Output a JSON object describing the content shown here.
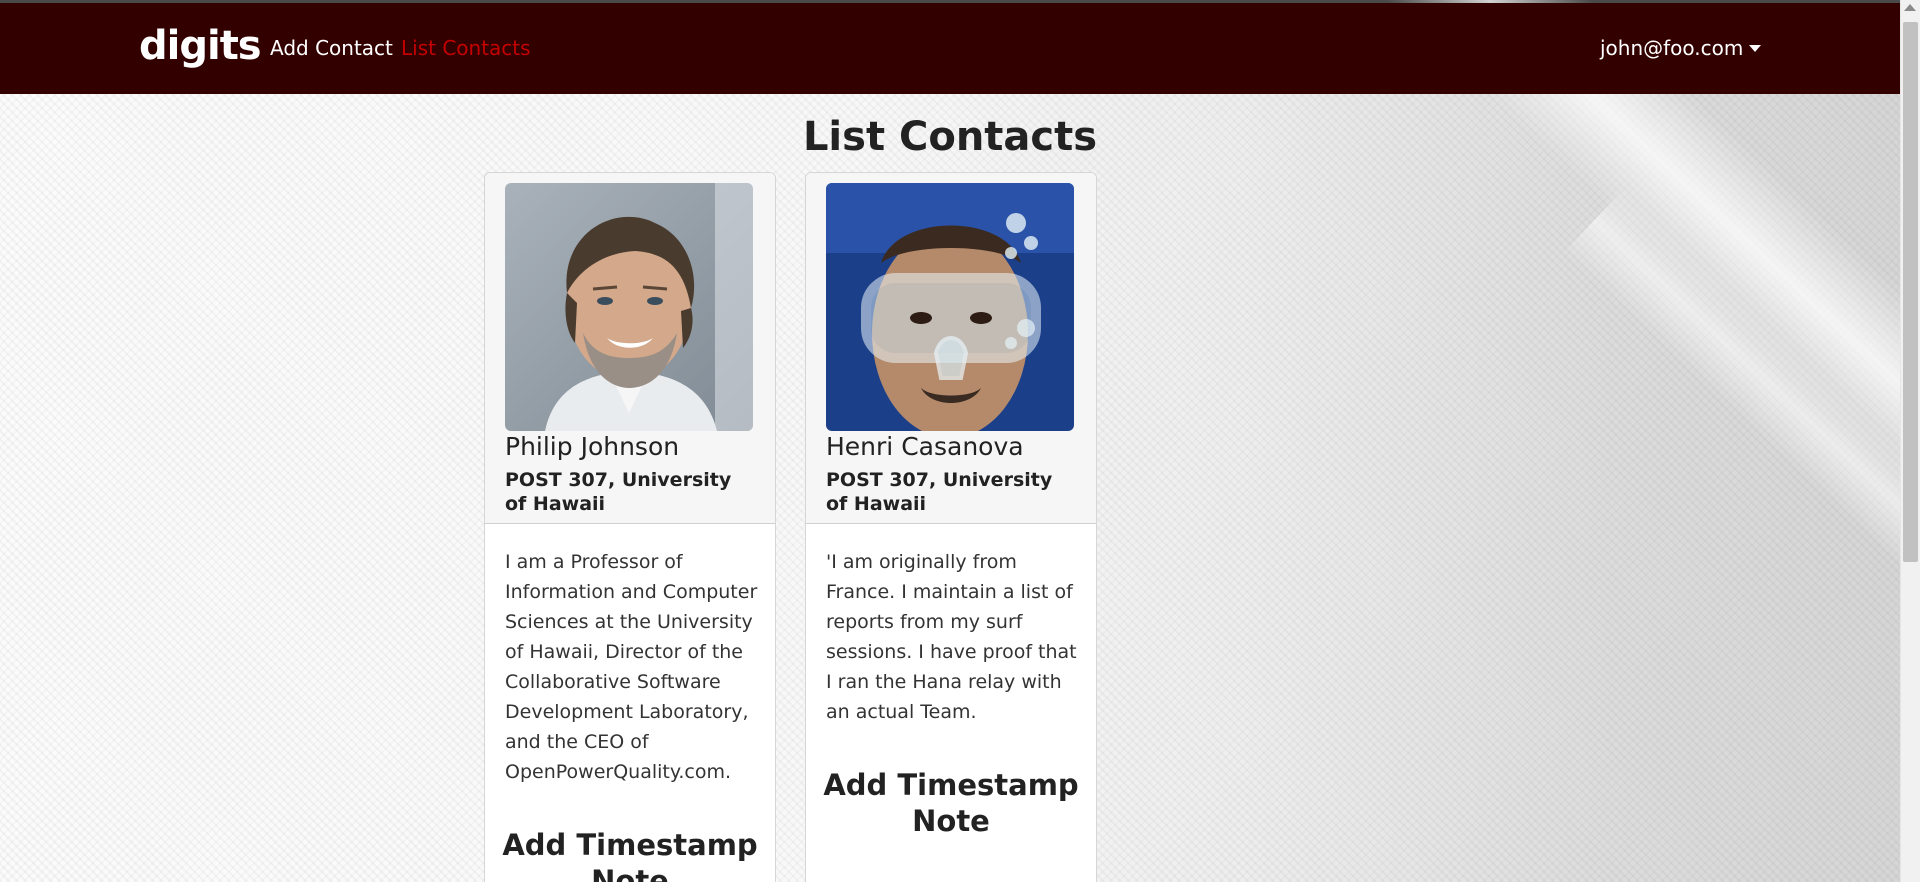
{
  "navbar": {
    "brand": "digits",
    "links": [
      {
        "label": "Add Contact",
        "active": false
      },
      {
        "label": "List Contacts",
        "active": true
      }
    ],
    "user": "john@foo.com",
    "colors": {
      "background": "#330000",
      "active_link": "#c40000"
    }
  },
  "page": {
    "title": "List Contacts"
  },
  "contacts": [
    {
      "name": "Philip Johnson",
      "address": "POST 307, University of Hawaii",
      "description": "I am a Professor of Information and Computer Sciences at the University of Hawaii, Director of the Collaborative Software Development Laboratory, and the CEO of OpenPowerQuality.com.",
      "action": "Add Timestamp Note"
    },
    {
      "name": "Henri Casanova",
      "address": "POST 307, University of Hawaii",
      "description": "'I am originally from France. I maintain a list of reports from my surf sessions. I have proof that I ran the Hana relay with an actual Team.",
      "action": "Add Timestamp Note"
    }
  ]
}
